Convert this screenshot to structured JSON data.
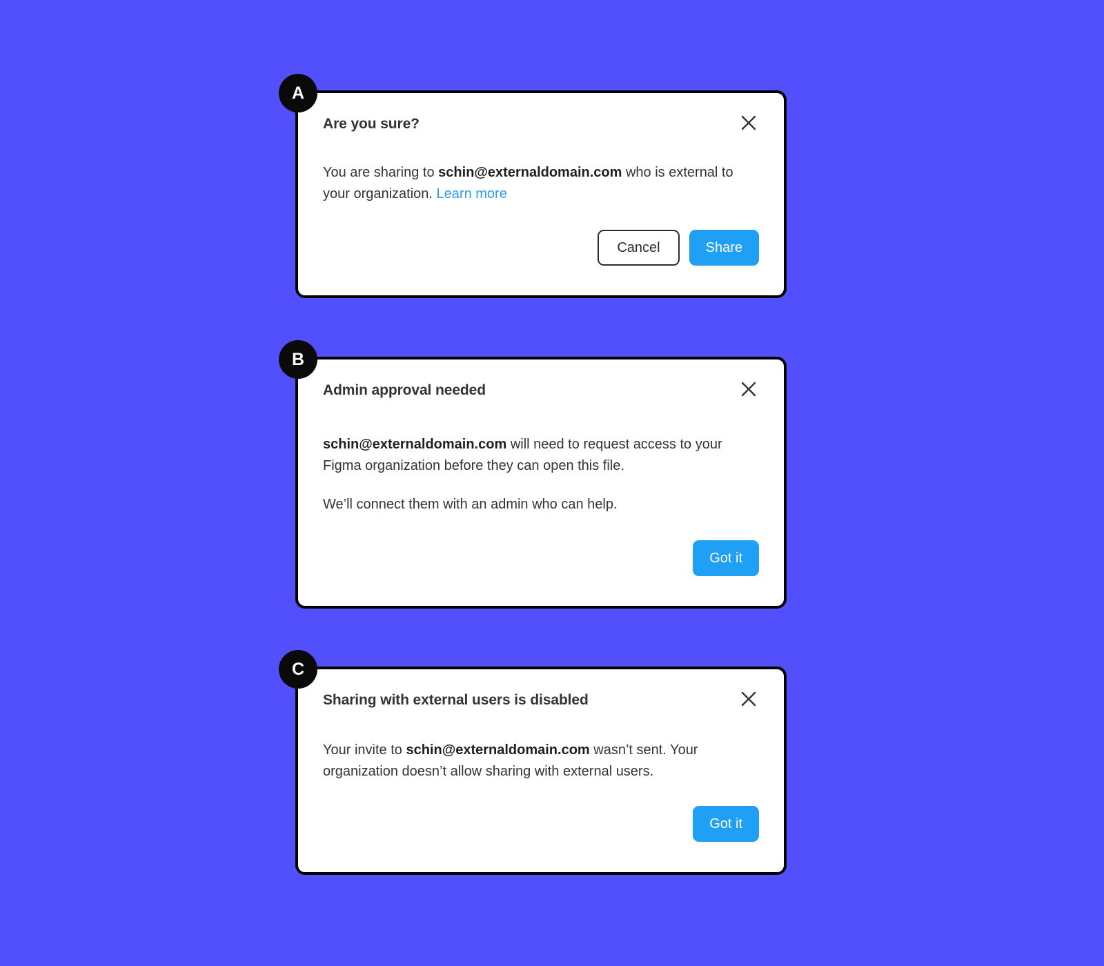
{
  "theme": {
    "background_color": "#5150fc",
    "card_background": "#ffffff",
    "card_border_color": "#000000",
    "badge_color": "#0a0a0a",
    "primary_button_color": "#1fa0f5",
    "link_color": "#2f9cf4",
    "text_color": "#333333"
  },
  "cards": [
    {
      "badge": "A",
      "title": "Are you sure?",
      "close_icon": "close-icon",
      "body": {
        "line1_prefix": "You are sharing to ",
        "line1_bold": "schin@externaldomain.com",
        "line1_suffix": " who is external to your organization. ",
        "link_label": "Learn more"
      },
      "buttons": {
        "secondary": "Cancel",
        "primary": "Share"
      }
    },
    {
      "badge": "B",
      "title": "Admin approval needed",
      "close_icon": "close-icon",
      "body": {
        "p1_bold": "schin@externaldomain.com",
        "p1_suffix": " will need to request access to your Figma organization before they can open this file.",
        "p2": "We’ll connect them with an admin who can help."
      },
      "buttons": {
        "primary": "Got it"
      }
    },
    {
      "badge": "C",
      "title": "Sharing with external users is disabled",
      "close_icon": "close-icon",
      "body": {
        "p1_prefix": "Your invite to ",
        "p1_bold": "schin@externaldomain.com",
        "p1_suffix": " wasn’t sent. Your organization doesn’t allow sharing with external users."
      },
      "buttons": {
        "primary": "Got it"
      }
    }
  ]
}
